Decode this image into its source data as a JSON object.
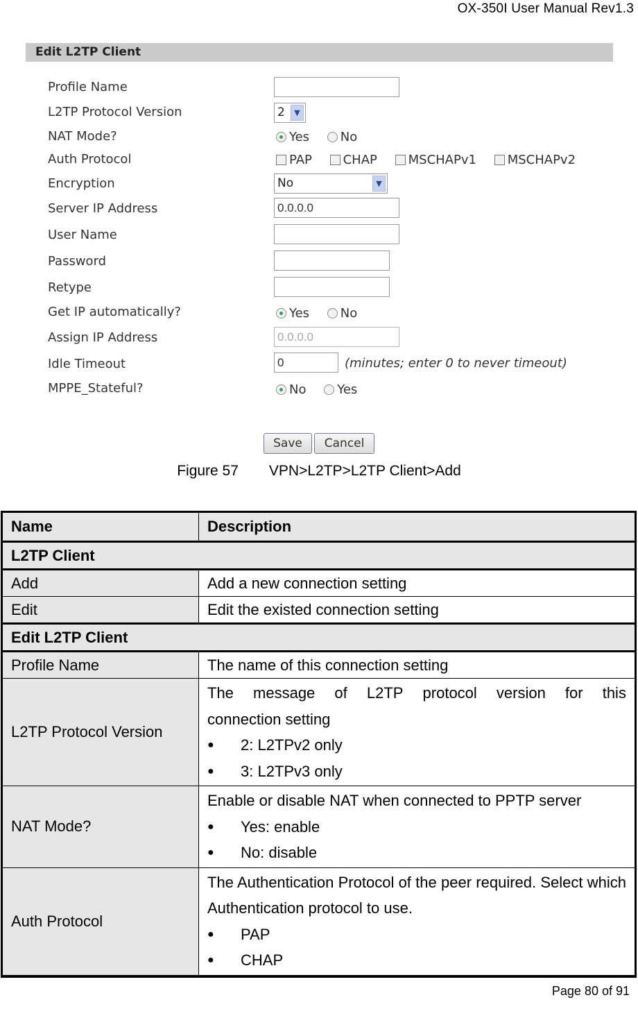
{
  "document": {
    "header": "OX-350I  User  Manual  Rev1.3",
    "footer": "Page 80 of 91"
  },
  "form": {
    "title": "Edit L2TP Client",
    "fields": {
      "profile_name": {
        "label": "Profile Name",
        "value": ""
      },
      "protocol_version": {
        "label": "L2TP Protocol Version",
        "value": "2"
      },
      "nat_mode": {
        "label": "NAT Mode?",
        "options": [
          "Yes",
          "No"
        ],
        "selected": "Yes"
      },
      "auth_protocol": {
        "label": "Auth Protocol",
        "options": [
          "PAP",
          "CHAP",
          "MSCHAPv1",
          "MSCHAPv2"
        ],
        "checked": []
      },
      "encryption": {
        "label": "Encryption",
        "value": "No"
      },
      "server_ip": {
        "label": "Server IP Address",
        "value": "0.0.0.0"
      },
      "user_name": {
        "label": "User Name",
        "value": ""
      },
      "password": {
        "label": "Password",
        "value": ""
      },
      "retype": {
        "label": "Retype",
        "value": ""
      },
      "get_ip_auto": {
        "label": "Get IP automatically?",
        "options": [
          "Yes",
          "No"
        ],
        "selected": "Yes"
      },
      "assign_ip": {
        "label": "Assign IP Address",
        "value": "0.0.0.0"
      },
      "idle_timeout": {
        "label": "Idle Timeout",
        "value": "0",
        "hint": "(minutes; enter 0 to never timeout)"
      },
      "mppe_stateful": {
        "label": "MPPE_Stateful?",
        "options": [
          "No",
          "Yes"
        ],
        "selected": "No"
      }
    },
    "buttons": {
      "save": "Save",
      "cancel": "Cancel"
    }
  },
  "caption": {
    "number": "Figure 57",
    "text": "VPN>L2TP>L2TP Client>Add"
  },
  "table": {
    "headers": {
      "name": "Name",
      "description": "Description"
    },
    "sections": [
      {
        "title": "L2TP Client",
        "rows": [
          {
            "name": "Add",
            "description": "Add a new connection setting"
          },
          {
            "name": "Edit",
            "description": "Edit the existed connection setting"
          }
        ]
      },
      {
        "title": "Edit L2TP Client",
        "rows": [
          {
            "name": "Profile Name",
            "description": "The name of this connection setting"
          },
          {
            "name": "L2TP Protocol Version",
            "description_first": "The message of L2TP protocol version for this",
            "description_rest": "connection setting",
            "bullets": [
              "2: L2TPv2 only",
              "3: L2TPv3 only"
            ]
          },
          {
            "name": "NAT Mode?",
            "description": "Enable or disable NAT when connected to PPTP server",
            "bullets": [
              "Yes: enable",
              "No: disable"
            ]
          },
          {
            "name": "Auth Protocol",
            "description": "The Authentication Protocol of the peer required. Select which Authentication protocol to use.",
            "bullets": [
              "PAP",
              "CHAP"
            ]
          }
        ]
      }
    ]
  }
}
